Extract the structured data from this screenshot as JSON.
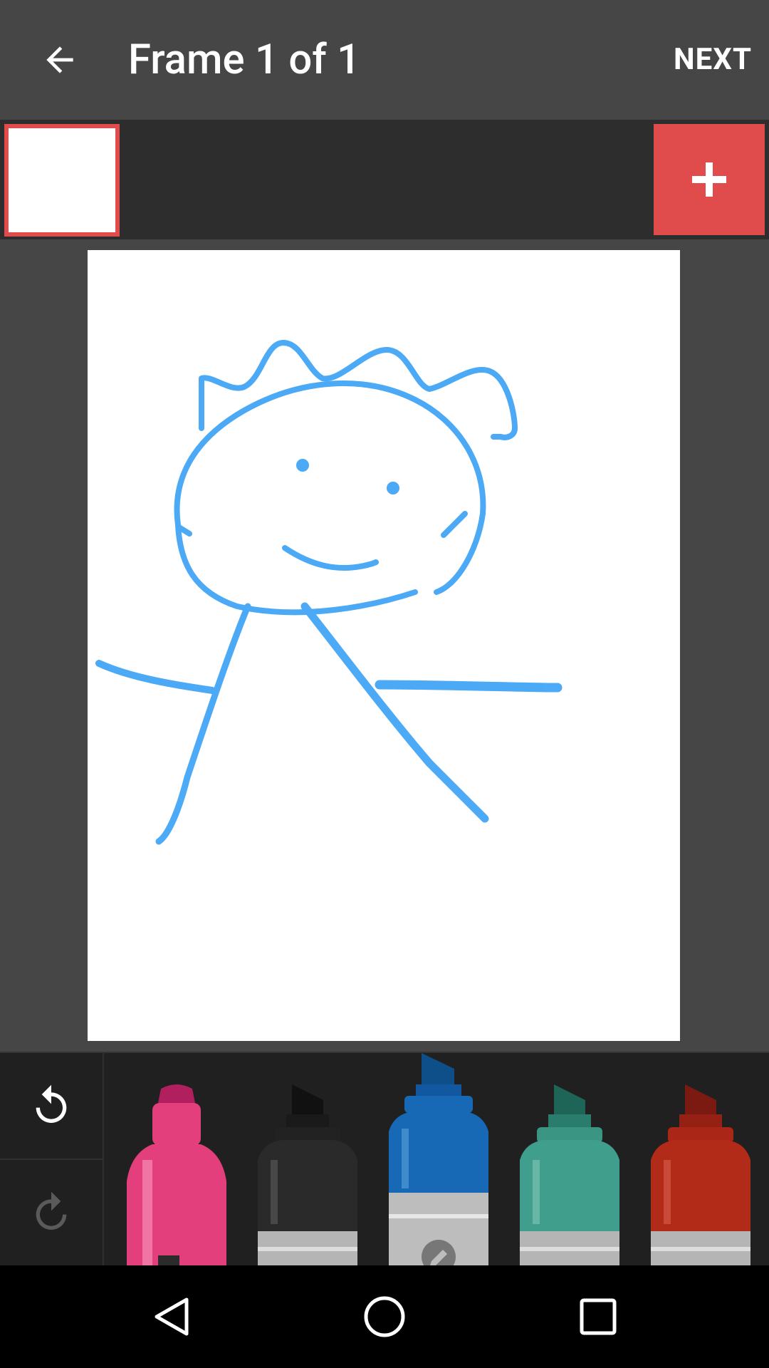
{
  "appbar": {
    "title": "Frame 1 of 1",
    "next_label": "NEXT"
  },
  "frames": {
    "add_label": "+"
  },
  "tools": {
    "markers": [
      {
        "name": "pink",
        "color": "#e33f7c"
      },
      {
        "name": "black",
        "color": "#2a2a2a"
      },
      {
        "name": "blue",
        "color": "#1769b5",
        "selected": true
      },
      {
        "name": "teal",
        "color": "#3f9e8c"
      },
      {
        "name": "red",
        "color": "#b22a18"
      }
    ]
  },
  "colors": {
    "accent": "#e04b4b",
    "stroke": "#42a5f5"
  }
}
